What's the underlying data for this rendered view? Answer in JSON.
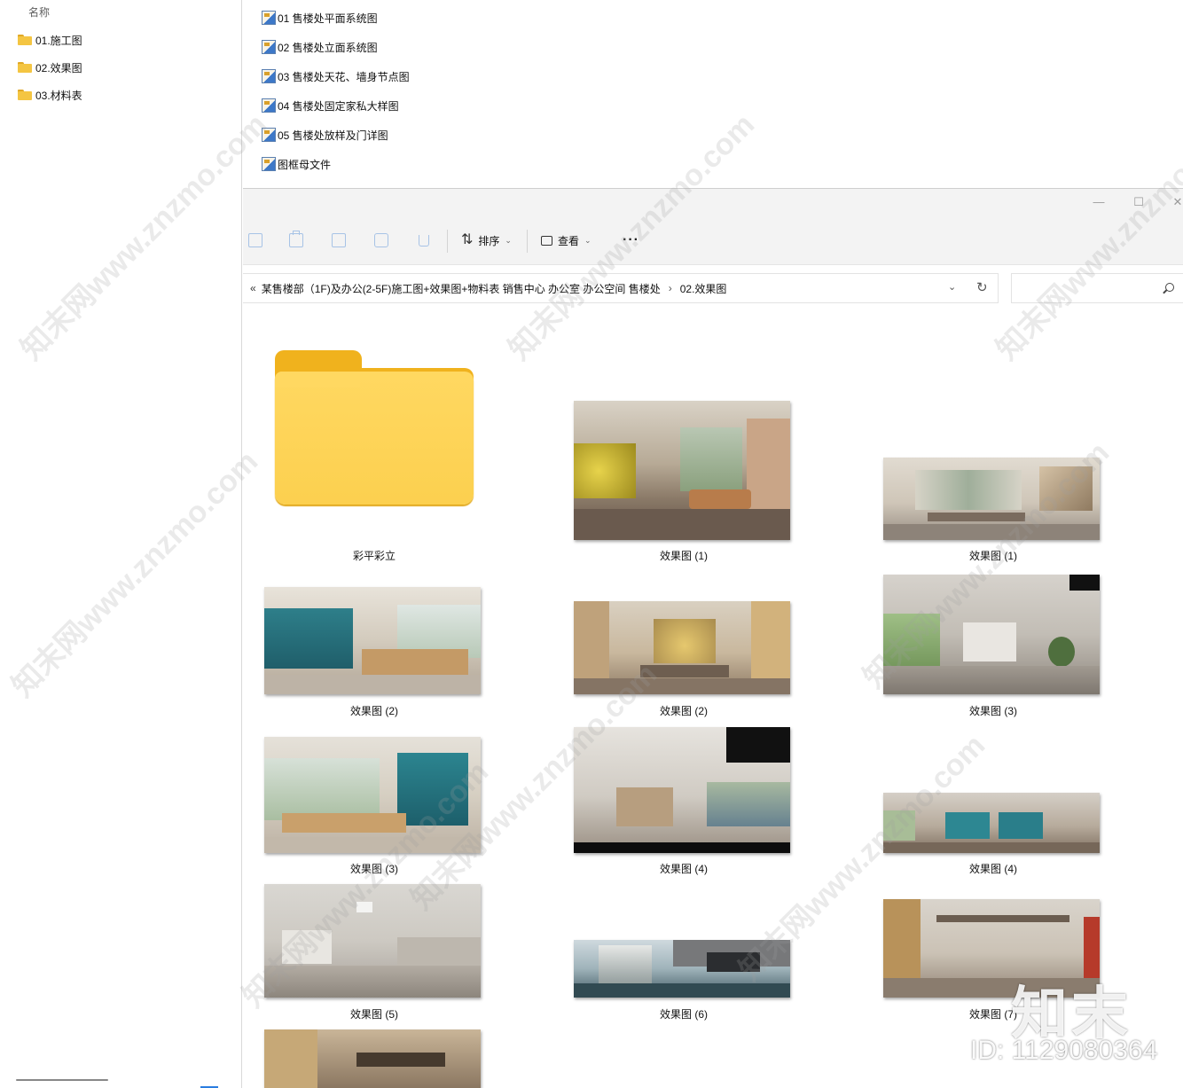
{
  "left_pane": {
    "header": "名称",
    "folders": [
      "01.施工图",
      "02.效果图",
      "03.材料表"
    ]
  },
  "top_files": [
    "01 售楼处平面系统图",
    "02 售楼处立面系统图",
    "03 售楼处天花、墙身节点图",
    "04 售楼处固定家私大样图",
    "05 售楼处放样及门详图",
    "图框母文件"
  ],
  "window": {
    "minimize": "—",
    "maximize": "☐",
    "close": "✕"
  },
  "toolbar": {
    "sort_label": "排序",
    "view_label": "查看",
    "more_label": "···",
    "chevron": "⌄"
  },
  "address": {
    "back_chevron": "«",
    "path": "某售楼部（1F)及办公(2-5F)施工图+效果图+物料表  销售中心 办公室 办公空间 售楼处",
    "separator": "›",
    "current": "02.效果图",
    "dropdown": "⌄",
    "refresh": "↻"
  },
  "grid": {
    "folder_caption": "彩平彩立",
    "captions": [
      "效果图 (1)",
      "效果图 (1)",
      "效果图 (2)",
      "效果图 (2)",
      "效果图 (3)",
      "效果图 (3)",
      "效果图 (4)",
      "效果图 (4)",
      "效果图 (5)",
      "效果图 (6)",
      "效果图 (7)"
    ]
  },
  "watermark": {
    "text": "知末网www.znzmo.com",
    "logo": "知末",
    "id": "ID: 1129080364"
  }
}
